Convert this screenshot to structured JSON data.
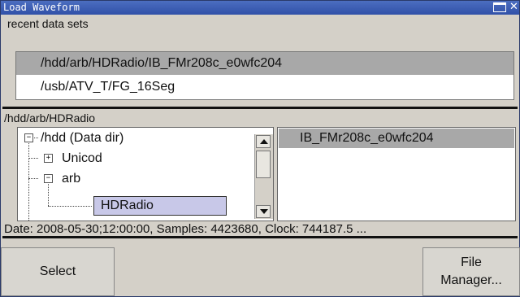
{
  "window": {
    "title": "Load Waveform"
  },
  "recent": {
    "label": "recent data sets",
    "items": [
      "/hdd/arb/HDRadio/IB_FMr208c_e0wfc204",
      "/usb/ATV_T/FG_16Seg"
    ]
  },
  "current_path": "/hdd/arb/HDRadio",
  "tree": {
    "items": [
      {
        "label": "/hdd (Data dir)",
        "toggle": "−"
      },
      {
        "label": "Unicod",
        "toggle": "+"
      },
      {
        "label": "arb",
        "toggle": "−"
      },
      {
        "label": "HDRadio"
      }
    ]
  },
  "files": [
    "IB_FMr208c_e0wfc204"
  ],
  "info": "Date: 2008-05-30;12:00:00, Samples: 4423680, Clock: 744187.5 ...",
  "buttons": {
    "select": "Select",
    "file_manager_line1": "File",
    "file_manager_line2": "Manager..."
  },
  "icons": {
    "maximize": "maximize-icon",
    "close": "close-icon"
  }
}
